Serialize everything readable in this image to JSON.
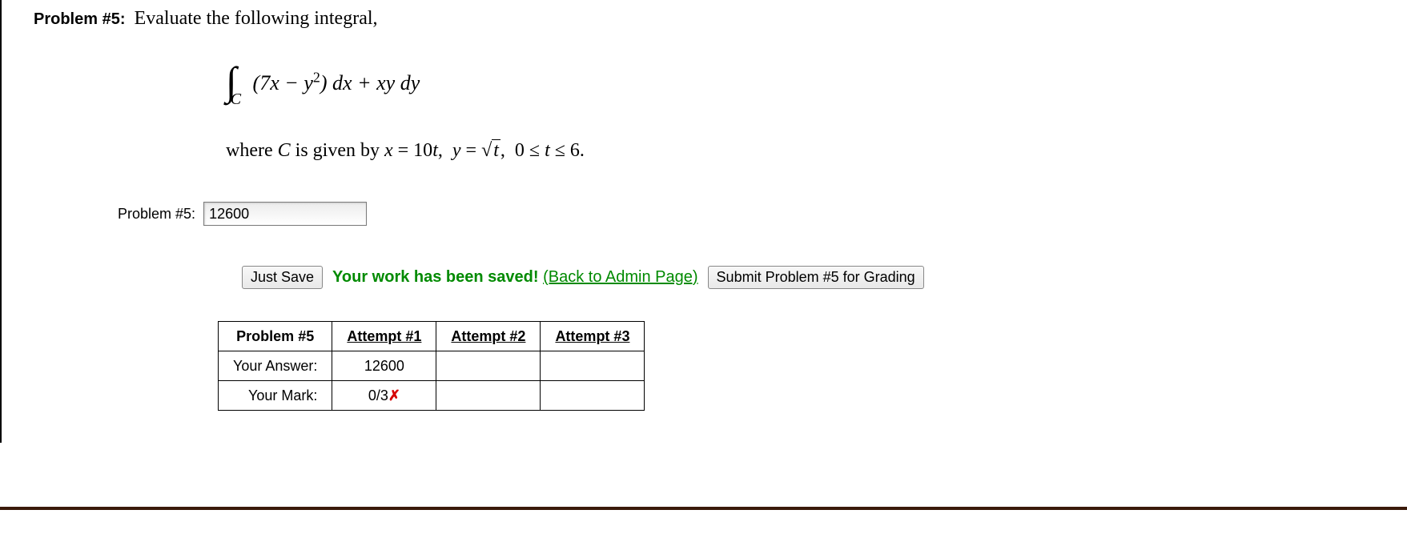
{
  "problem": {
    "label": "Problem #5:",
    "prompt": "Evaluate the following integral,",
    "formula_integral": "(7x − y²) dx + xy dy",
    "curve_line_pre": "where ",
    "curve_var": "C",
    "curve_line_mid": " is given by ",
    "curve_param_x": "x = 10t",
    "curve_param_sep": ",  ",
    "curve_param_y_pre": "y = ",
    "curve_sqrt_var": "t",
    "curve_param_y_post": ",  0 ≤ t ≤ 6."
  },
  "answer": {
    "label": "Problem #5:",
    "value": "12600"
  },
  "actions": {
    "just_save": "Just Save",
    "saved_msg": "Your work has been saved!",
    "admin_link": "(Back to Admin Page)",
    "submit": "Submit Problem #5 for Grading"
  },
  "results": {
    "header_problem": "Problem #5",
    "attempts": [
      "Attempt #1",
      "Attempt #2",
      "Attempt #3"
    ],
    "row_answer": "Your Answer:",
    "row_mark": "Your Mark:",
    "values_answer": [
      "12600",
      "",
      ""
    ],
    "values_mark_prefix": [
      "0/3",
      "",
      ""
    ],
    "values_mark_x": [
      "✗",
      "",
      ""
    ]
  },
  "chart_data": {
    "type": "table",
    "title": "Problem #5 attempts",
    "columns": [
      "Attempt #1",
      "Attempt #2",
      "Attempt #3"
    ],
    "rows": [
      {
        "label": "Your Answer:",
        "values": [
          "12600",
          "",
          ""
        ]
      },
      {
        "label": "Your Mark:",
        "values": [
          "0/3 ✗",
          "",
          ""
        ]
      }
    ]
  }
}
